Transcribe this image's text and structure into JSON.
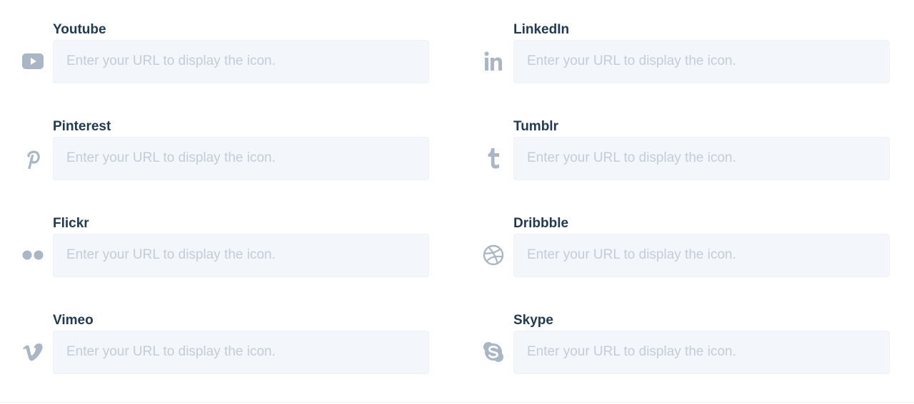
{
  "social": {
    "placeholder": "Enter your URL to display the icon.",
    "fields": [
      {
        "label": "Youtube",
        "icon": "youtube-icon"
      },
      {
        "label": "LinkedIn",
        "icon": "linkedin-icon"
      },
      {
        "label": "Pinterest",
        "icon": "pinterest-icon"
      },
      {
        "label": "Tumblr",
        "icon": "tumblr-icon"
      },
      {
        "label": "Flickr",
        "icon": "flickr-icon"
      },
      {
        "label": "Dribbble",
        "icon": "dribbble-icon"
      },
      {
        "label": "Vimeo",
        "icon": "vimeo-icon"
      },
      {
        "label": "Skype",
        "icon": "skype-icon"
      }
    ]
  },
  "colors": {
    "label": "#1e3a56",
    "icon": "#a9b6c6",
    "input_bg": "#f3f6fa",
    "placeholder": "#c3cdd8"
  }
}
